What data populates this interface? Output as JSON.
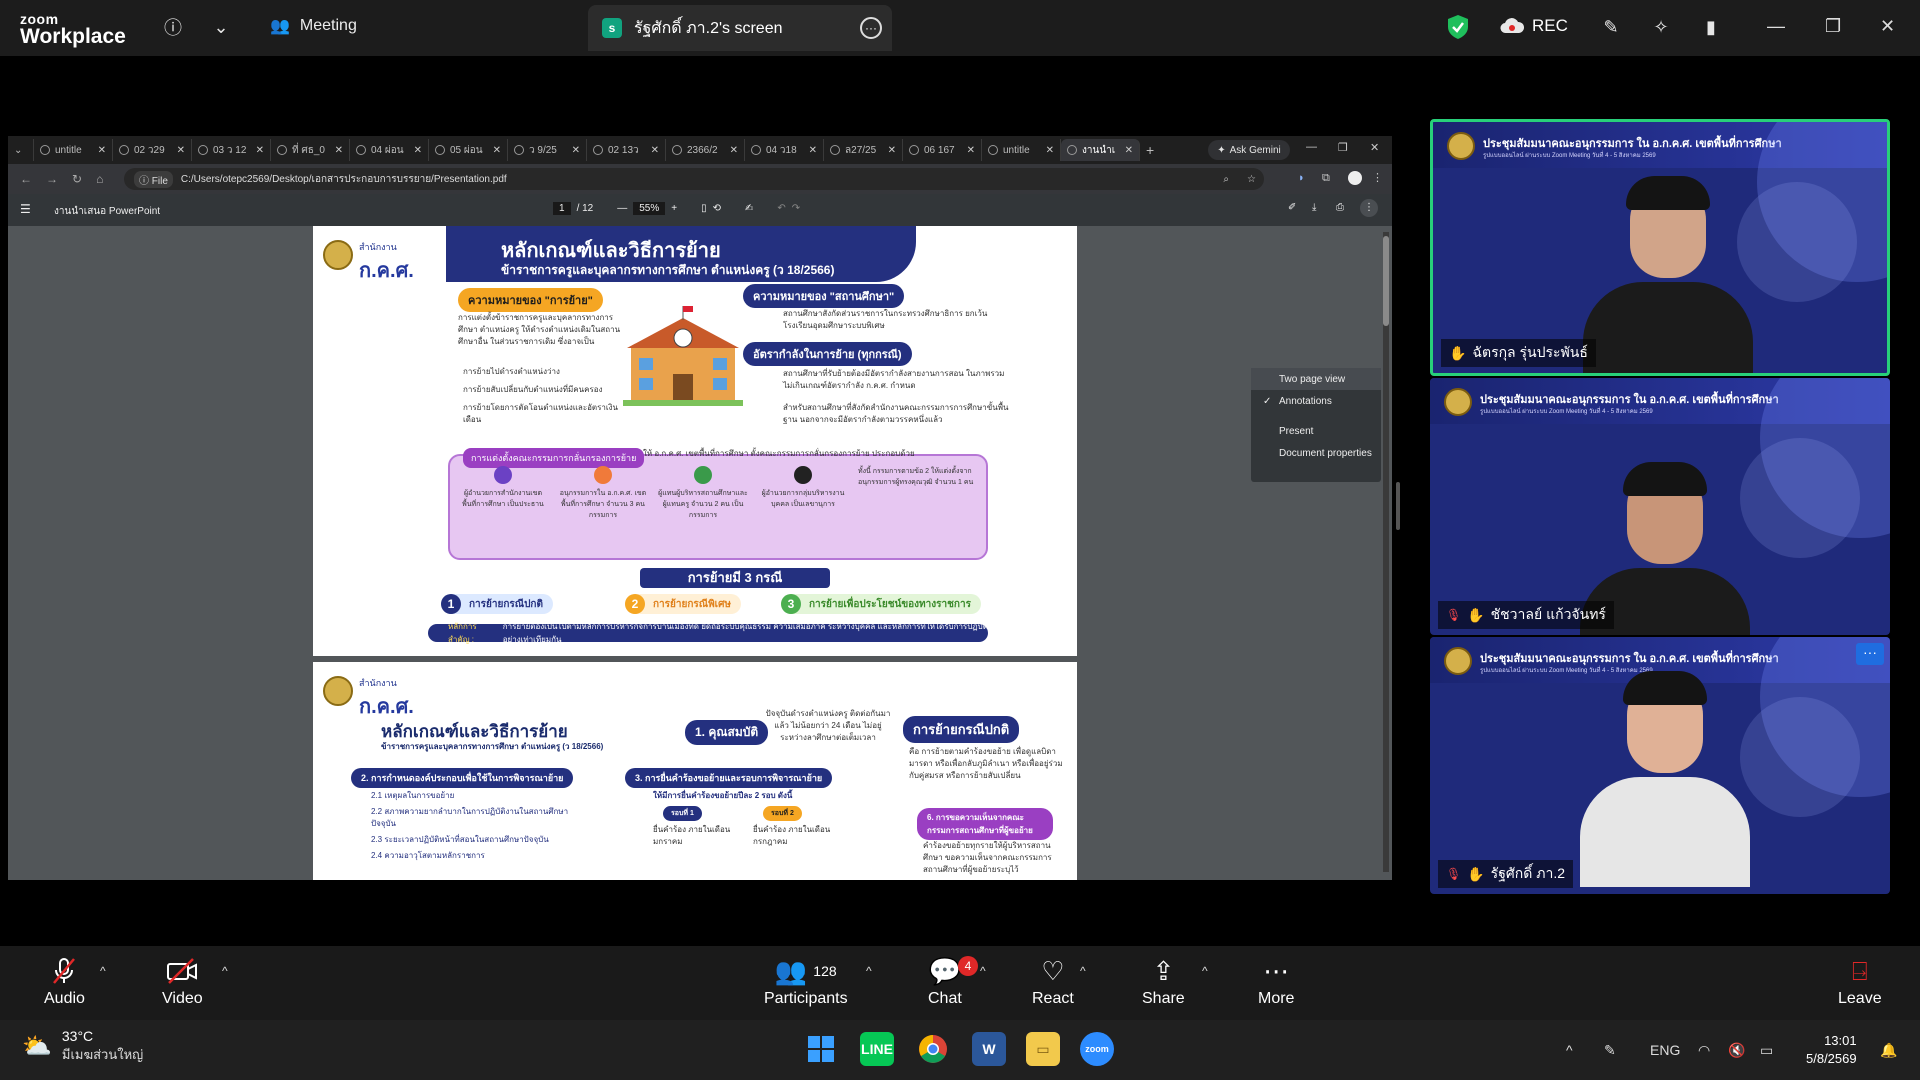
{
  "zoom": {
    "logo_line1": "zoom",
    "logo_line2": "Workplace",
    "meeting_label": "Meeting",
    "screen_share_label": "รัฐศักดิ์ ภา.2's screen",
    "screen_share_badge": "s",
    "rec_label": "REC"
  },
  "browser": {
    "tabs": [
      "untitle",
      "02 ว29",
      "03 ว 12",
      "ที่ ศธ_0",
      "04 ผ่อน",
      "05 ผ่อน",
      "ว 9/25",
      "02 13ว",
      "2366/2",
      "04 ว18",
      "ล27/25",
      "06 167",
      "untitle",
      "งานนำเ"
    ],
    "ask_gemini": "Ask Gemini",
    "address_scheme": "File",
    "address_url": "C:/Users/otepc2569/Desktop/เอกสารประกอบการบรรยาย/Presentation.pdf"
  },
  "pdf": {
    "title": "งานนำเสนอ PowerPoint",
    "page_current": "1",
    "page_total": "/ 12",
    "zoom": "55%",
    "menu": {
      "two_page": "Two page view",
      "annotations": "Annotations",
      "present": "Present",
      "properties": "Document properties"
    },
    "page1": {
      "org_small": "สำนักงาน",
      "org_big": "ก.ค.ศ.",
      "title": "หลักเกณฑ์และวิธีการย้าย",
      "subtitle": "ข้าราชการครูและบุคลากรทางการศึกษา ตำแหน่งครู (ว 18/2566)",
      "meaning_move": "ความหมายของ \"การย้าย\"",
      "meaning_move_text": "การแต่งตั้งข้าราชการครูและบุคลากรทางการศึกษา ตำแหน่งครู ให้ดำรงตำแหน่งเดิมในสถานศึกษาอื่น ในส่วนราชการเดิม ซึ่งอาจเป็น",
      "bullet1": "การย้ายไปดำรงตำแหน่งว่าง",
      "bullet2": "การย้ายสับเปลี่ยนกับตำแหน่งที่มีคนครอง",
      "bullet3": "การย้ายโดยการตัดโอนตำแหน่งและอัตราเงินเดือน",
      "meaning_school": "ความหมายของ \"สถานศึกษา\"",
      "meaning_school_text": "สถานศึกษาสังกัดส่วนราชการในกระทรวงศึกษาธิการ ยกเว้น โรงเรียนอุดมศึกษาระบบพิเศษ",
      "staff_rate": "อัตรากำลังในการย้าย (ทุกกรณี)",
      "staff_rate_text1": "สถานศึกษาที่รับย้ายต้องมีอัตรากำลังสายงานการสอน ในภาพรวมไม่เกินเกณฑ์อัตรากำลัง ก.ค.ศ. กำหนด",
      "staff_rate_text2": "สำหรับสถานศึกษาที่สังกัดสำนักงานคณะกรรมการการศึกษาขั้นพื้นฐาน นอกจากจะมีอัตรากำลังตามวรรคหนึ่งแล้ว",
      "committee_tag": "การแต่งตั้งคณะกรรมการกลั่นกรองการย้าย",
      "committee_intro": "ให้ อ.ก.ค.ศ. เขตพื้นที่การศึกษา ตั้งคณะกรรมการกลั่นกรองการย้าย ประกอบด้วย",
      "member1": "ผู้อำนวยการสำนักงานเขตพื้นที่การศึกษา เป็นประธาน",
      "member2": "อนุกรรมการใน อ.ก.ค.ศ. เขตพื้นที่การศึกษา จำนวน 3 คน กรรมการ",
      "member3": "ผู้แทนผู้บริหารสถานศึกษาและผู้แทนครู จำนวน 2 คน เป็นกรรมการ",
      "member4": "ผู้อำนวยการกลุ่มบริหารงานบุคคล เป็นเลขานุการ",
      "member5": "ทั้งนี้ กรรมการตามข้อ 2 ให้แต่งตั้งจาก อนุกรรมการผู้ทรงคุณวุฒิ จำนวน 1 คน",
      "cases_title": "การย้ายมี 3 กรณี",
      "case1": "การย้ายกรณีปกติ",
      "case2": "การย้ายกรณีพิเศษ",
      "case3": "การย้ายเพื่อประโยชน์ของทางราชการ",
      "principle_label": "หลักการสำคัญ :",
      "principle_text": "การย้ายต้องเป็นไปตามหลักการบริหารกิจการบ้านเมืองที่ดี ยึดถือระบบคุณธรรม ความเสมอภาค ระหว่างบุคคล และหลักการที่ให้ได้รับการปฏิบัติอย่างเท่าเทียมกัน"
    },
    "page2": {
      "org_small": "สำนักงาน",
      "org_big": "ก.ค.ศ.",
      "title": "หลักเกณฑ์และวิธีการย้าย",
      "subtitle": "ข้าราชการครูและบุคลากรทางการศึกษา ตำแหน่งครู (ว 18/2566)",
      "qual": "1. คุณสมบัติ",
      "qual_text": "ปัจจุบันดำรงตำแหน่งครู ติดต่อกันมาแล้ว ไม่น้อยกว่า 24 เดือน ไม่อยู่ระหว่างลาศึกษาต่อเต็มเวลา",
      "normal_case": "การย้ายกรณีปกติ",
      "normal_case_text": "คือ การย้ายตามคำร้องขอย้าย เพื่อดูแลบิดา มารดา หรือเพื่อกลับภูมิลำเนา หรือเพื่ออยู่ร่วมกับคู่สมรส หรือการย้ายสับเปลี่ยน",
      "factors": "2. การกำหนดองค์ประกอบเพื่อใช้ในการพิจารณาย้าย",
      "submit": "3. การยื่นคำร้องขอย้ายและรอบการพิจารณาย้าย",
      "submit_text": "ให้มีการยื่นคำร้องขอย้ายปีละ 2 รอบ ดังนี้",
      "round1": "รอบที่ 1",
      "round1_text": "ยื่นคำร้อง ภายในเดือนมกราคม",
      "round2": "รอบที่ 2",
      "round2_text": "ยื่นคำร้อง ภายในเดือนกรกฎาคม",
      "factor1": "เหตุผลในการขอย้าย",
      "factor2": "สภาพความยากลำบากในการปฏิบัติงานในสถานศึกษาปัจจุบัน",
      "factor3": "ระยะเวลาปฏิบัติหน้าที่สอนในสถานศึกษาปัจจุบัน",
      "factor4": "ความอาวุโสตามหลักราชการ",
      "opinion": "6. การขอความเห็นจากคณะกรรมการสถานศึกษาที่ผู้ขอย้าย",
      "opinion_text": "คำร้องขอย้ายทุกรายให้ผู้บริหารสถานศึกษา ขอความเห็นจากคณะกรรมการสถานศึกษาที่ผู้ขอย้ายระบุไว้"
    }
  },
  "tiles": [
    {
      "header": "ประชุมสัมมนาคณะอนุกรรมการ ใน อ.ก.ค.ศ. เขตพื้นที่การศึกษา",
      "sub": "รูปแบบออนไลน์ ผ่านระบบ Zoom Meeting วันที่ 4 - 5 สิงหาคม 2569",
      "name": "ฉัตรกุล รุ่นประพันธ์"
    },
    {
      "header": "ประชุมสัมมนาคณะอนุกรรมการ ใน อ.ก.ค.ศ. เขตพื้นที่การศึกษา",
      "sub": "รูปแบบออนไลน์ ผ่านระบบ Zoom Meeting วันที่ 4 - 5 สิงหาคม 2569",
      "name": "ชัชวาลย์ แก้วจันทร์"
    },
    {
      "header": "ประชุมสัมมนาคณะอนุกรรมการ ใน อ.ก.ค.ศ. เขตพื้นที่การศึกษา",
      "sub": "รูปแบบออนไลน์ ผ่านระบบ Zoom Meeting วันที่ 4 - 5 สิงหาคม 2569",
      "name": "รัฐศักดิ์ ภา.2"
    }
  ],
  "toolbar": {
    "audio": "Audio",
    "video": "Video",
    "participants": "Participants",
    "participants_count": "128",
    "chat": "Chat",
    "chat_badge": "4",
    "react": "React",
    "share": "Share",
    "more": "More",
    "leave": "Leave"
  },
  "taskbar": {
    "temp": "33°C",
    "condition": "มีเมฆส่วนใหญ่",
    "lang": "ENG",
    "time": "13:01",
    "date": "5/8/2569"
  },
  "colors": {
    "zoom_bg": "#1c1c1c",
    "active_speaker": "#28d07a",
    "slide_navy": "#24307f",
    "rec_red": "#e02828"
  }
}
